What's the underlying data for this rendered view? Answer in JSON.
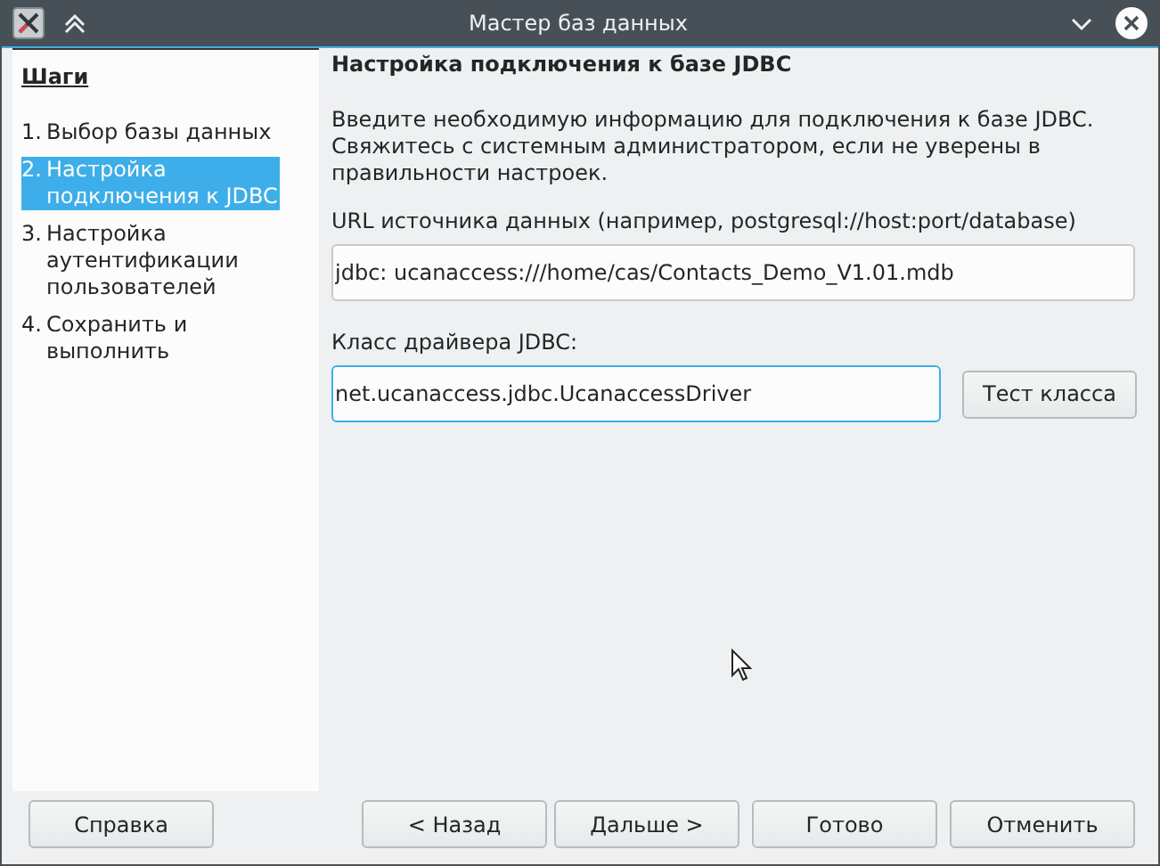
{
  "window": {
    "title": "Мастер баз данных"
  },
  "steps": {
    "title": "Шаги",
    "items": [
      {
        "number": "1.",
        "label": "Выбор базы данных",
        "selected": false
      },
      {
        "number": "2.",
        "label": "Настройка подключения к JDBC",
        "selected": true
      },
      {
        "number": "3.",
        "label": "Настройка аутентификации пользователей",
        "selected": false
      },
      {
        "number": "4.",
        "label": "Сохранить и выполнить",
        "selected": false
      }
    ]
  },
  "page": {
    "heading": "Настройка подключения к базе JDBC",
    "intro": "Введите необходимую информацию для подключения к базе JDBC. Свяжитесь с системным администратором, если не уверены в правильности настроек.",
    "url_label": "URL источника данных (например, postgresql://host:port/database)",
    "url_value": "jdbc: ucanaccess:///home/cas/Contacts_Demo_V1.01.mdb",
    "driver_label": "Класс драйвера JDBC:",
    "driver_value": "net.ucanaccess.jdbc.UcanaccessDriver",
    "driver_focused": true,
    "test_button": "Тест класса"
  },
  "help_button": "Справка",
  "buttons": [
    "< Назад",
    "Дальше >",
    "Готово",
    "Отменить"
  ]
}
